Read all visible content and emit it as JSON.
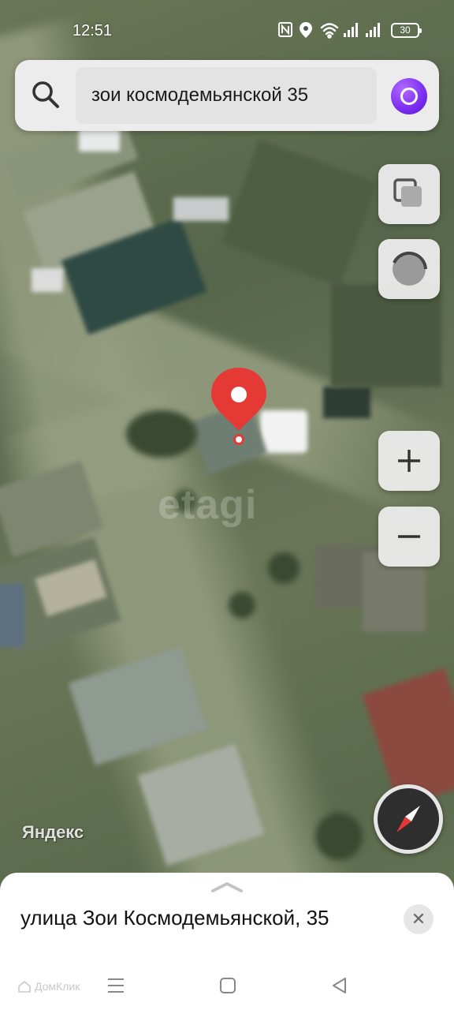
{
  "status_bar": {
    "time": "12:51",
    "battery_level": "30",
    "icons": [
      "nfc-icon",
      "location-icon",
      "wifi-icon",
      "signal-icon",
      "signal-icon",
      "battery-icon"
    ]
  },
  "search": {
    "query": "зои космодемьянской 35",
    "icon": "search-icon",
    "assistant_icon": "alice-icon"
  },
  "map": {
    "watermark": "etagi",
    "provider_logo": "Яндекс",
    "controls": [
      "layers-icon",
      "route-icon",
      "zoom-in-icon",
      "zoom-out-icon",
      "compass-icon"
    ]
  },
  "place_card": {
    "address": "улица Зои Космодемьянской, 35",
    "close_label": "✕"
  },
  "bottom_overlay": {
    "domclick_label": "ДомКлик"
  },
  "colors": {
    "pin": "#e53935",
    "alice_purple": "#7a2cf0",
    "control_bg": "#ececec",
    "sheet_bg": "#ffffff"
  }
}
